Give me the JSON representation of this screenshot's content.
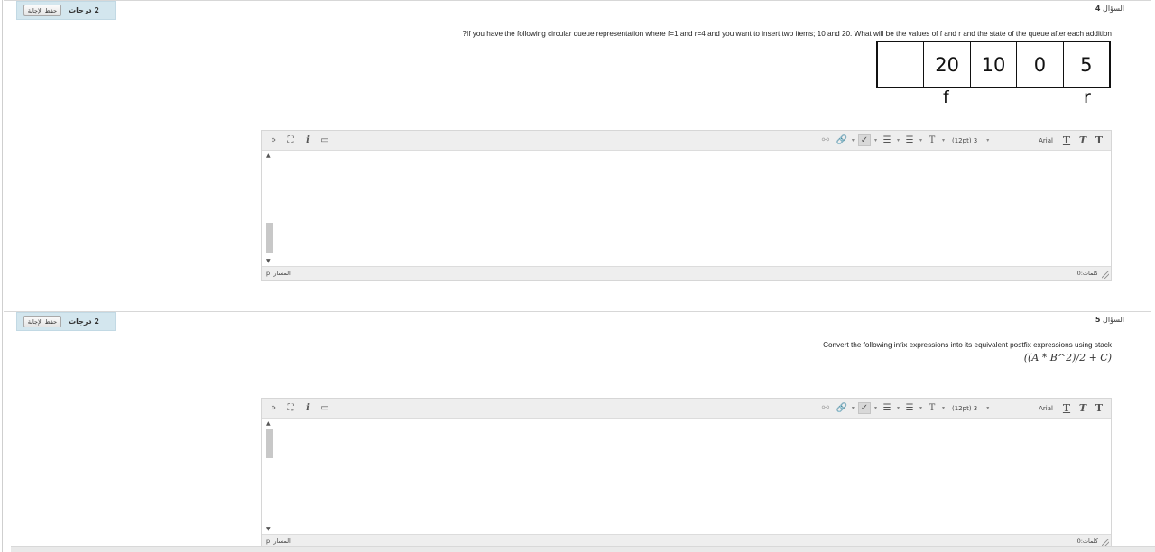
{
  "questions": [
    {
      "label": "السؤال",
      "number": "4",
      "grade": "2 درجات",
      "save_label": "حفظ الإجابة",
      "text": "?If you have the following circular queue representation where f=1 and r=4 and you want to insert two items; 10 and 20. What will be the values of f and r and the state of the queue after each addition",
      "queue_cells": [
        "",
        "20",
        "10",
        "0",
        "5"
      ],
      "pointers": {
        "front": "f",
        "rear": "r"
      },
      "editor": {
        "font_size": "(12pt) 3",
        "font_family": "Arial",
        "path": "المسار: p",
        "word_count": "كلمات:0"
      }
    },
    {
      "label": "السؤال",
      "number": "5",
      "grade": "2 درجات",
      "save_label": "حفظ الإجابة",
      "text": "Convert the following infix expressions into its equivalent postfix expressions using stack",
      "expression": "((A * B^2)/2 + C)",
      "editor": {
        "font_size": "(12pt) 3",
        "font_family": "Arial",
        "path": "المسار: p",
        "word_count": "كلمات:0"
      }
    }
  ],
  "icons": {
    "toolbar_left": [
      "collapse-icon",
      "fullscreen-icon",
      "italic-info-icon",
      "preview-icon"
    ],
    "toolbar_right": [
      "unlink-icon",
      "link-icon",
      "spellcheck-icon",
      "numbered-list-icon",
      "bullet-list-icon",
      "text-color-icon"
    ]
  },
  "colors": {
    "grade_panel": "#d3e6ee",
    "toolbar": "#eeeeee"
  }
}
